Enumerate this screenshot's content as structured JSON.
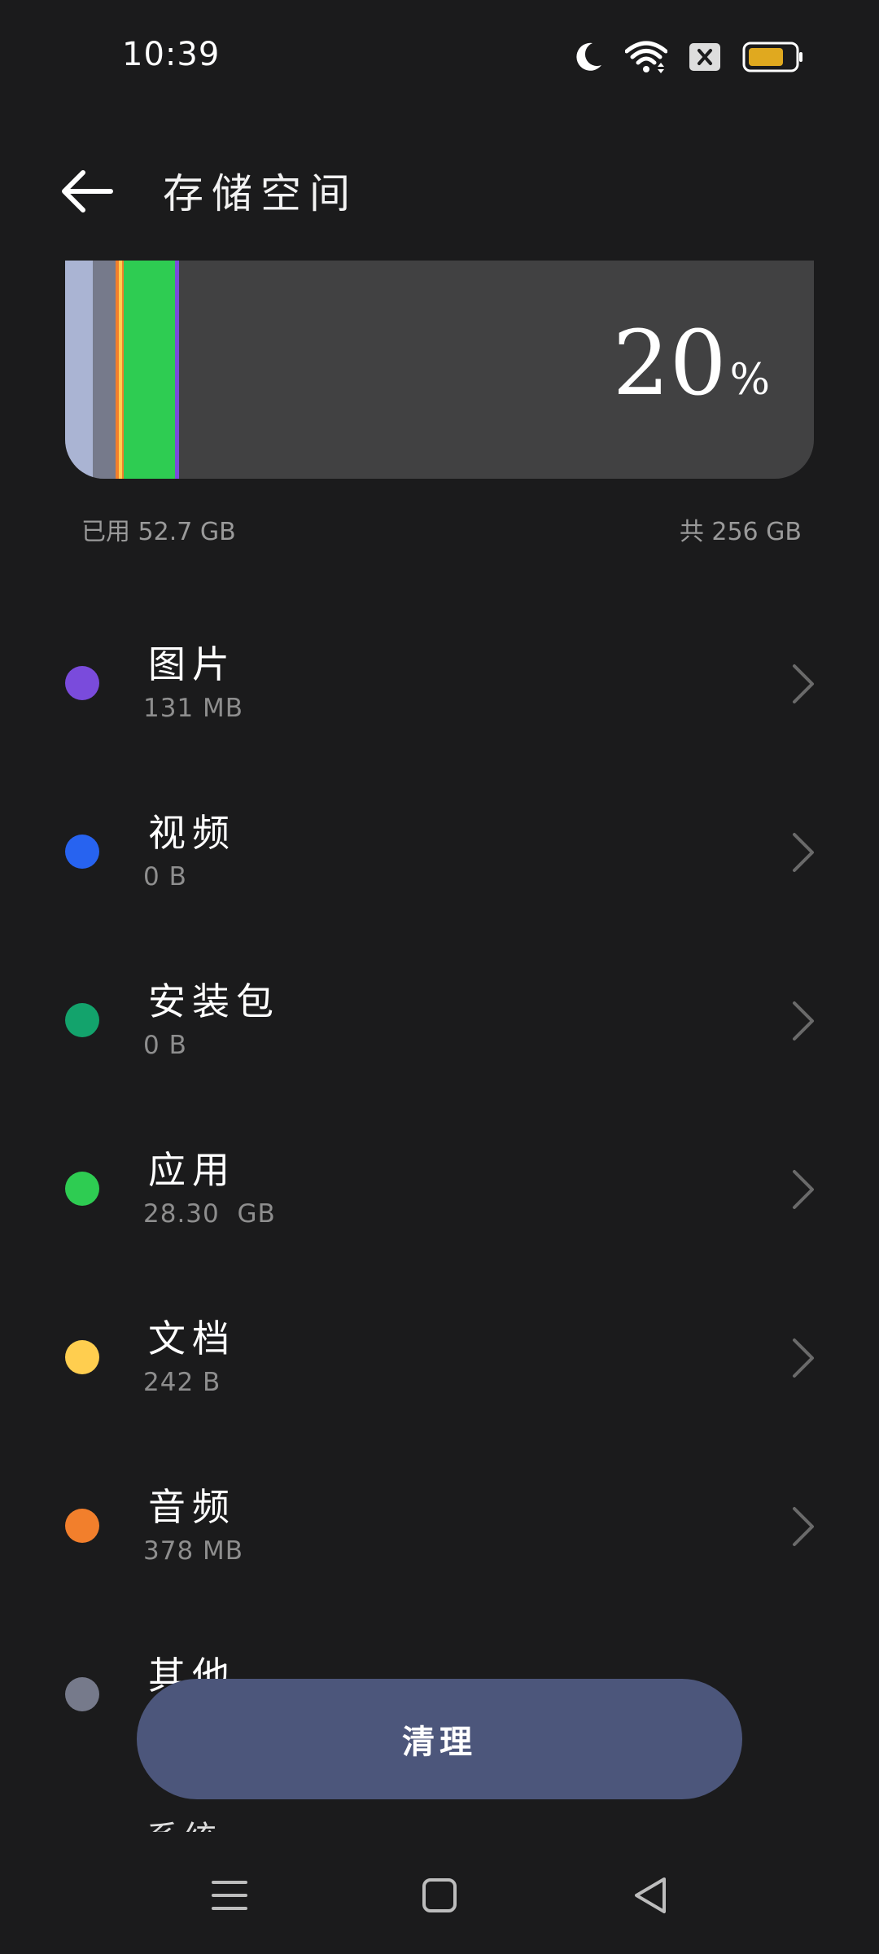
{
  "status_bar": {
    "time": "10:39",
    "icons": [
      "moon-icon",
      "wifi-icon",
      "sim-disabled-icon",
      "battery-icon"
    ],
    "battery_color": "#e0a91f"
  },
  "header": {
    "title": "存储空间"
  },
  "storage": {
    "percent": "20",
    "percent_sign": "%",
    "used_label": "已用 52.7 GB",
    "total_label": "共 256 GB",
    "segments": [
      {
        "name": "segment-a",
        "color": "#aab4d3",
        "fraction": 0.037
      },
      {
        "name": "segment-b",
        "color": "#767a8b",
        "fraction": 0.03
      },
      {
        "name": "segment-c",
        "color": "#f27f2c",
        "fraction": 0.004
      },
      {
        "name": "segment-d",
        "color": "#ffce4f",
        "fraction": 0.004
      },
      {
        "name": "segment-e",
        "color": "#f27f2c",
        "fraction": 0.002
      },
      {
        "name": "segment-apps",
        "color": "#2ecc52",
        "fraction": 0.068
      },
      {
        "name": "segment-f",
        "color": "#7a4bdc",
        "fraction": 0.005
      }
    ]
  },
  "categories": [
    {
      "title": "图片",
      "size": "131 MB",
      "color": "#7a4bdc"
    },
    {
      "title": "视频",
      "size": "0 B",
      "color": "#2763f0"
    },
    {
      "title": "安装包",
      "size": "0 B",
      "color": "#13a36c"
    },
    {
      "title": "应用",
      "size": "28.30  GB",
      "color": "#2ecc52"
    },
    {
      "title": "文档",
      "size": "242 B",
      "color": "#ffce4f"
    },
    {
      "title": "音频",
      "size": "378 MB",
      "color": "#f27f2c"
    },
    {
      "title": "其他",
      "size": "",
      "color": "#767a8b"
    }
  ],
  "actions": {
    "clean_label": "清理"
  },
  "peek": {
    "text": "系统"
  },
  "nav": {
    "icons": [
      "menu-icon",
      "home-icon",
      "back-triangle-icon"
    ]
  }
}
